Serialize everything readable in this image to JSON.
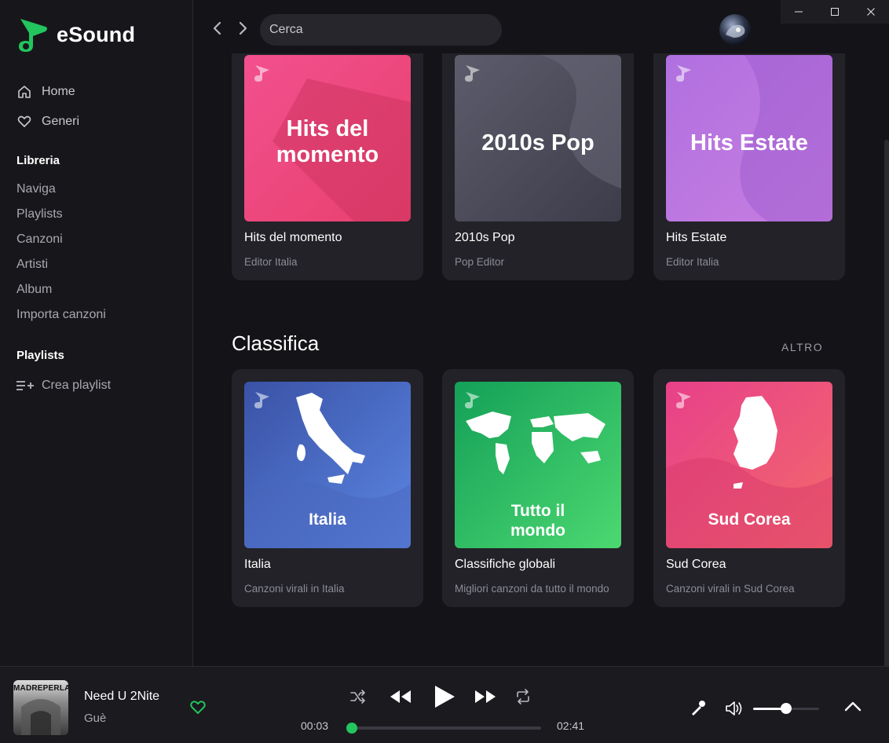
{
  "app": {
    "name": "eSound",
    "accent": "#22c55e"
  },
  "window": {
    "controls": [
      "minimize-icon",
      "maximize-icon",
      "close-icon"
    ]
  },
  "sidebar": {
    "main_nav": [
      {
        "label": "Home",
        "icon": "home-icon"
      },
      {
        "label": "Generi",
        "icon": "heart-icon"
      }
    ],
    "library_title": "Libreria",
    "library_items": [
      "Naviga",
      "Playlists",
      "Canzoni",
      "Artisti",
      "Album",
      "Importa canzoni"
    ],
    "playlists_title": "Playlists",
    "create_playlist": "Crea playlist"
  },
  "topbar": {
    "search_placeholder": "Cerca"
  },
  "sections": {
    "featured": {
      "cards": [
        {
          "art_title": "Hits del momento",
          "title": "Hits del momento",
          "subtitle": "Editor Italia",
          "colors": [
            "#f0508c",
            "#e8406e"
          ]
        },
        {
          "art_title": "2010s Pop",
          "title": "2010s Pop",
          "subtitle": "Pop Editor",
          "colors": [
            "#5a5a6a",
            "#3e3e4c"
          ]
        },
        {
          "art_title": "Hits Estate",
          "title": "Hits Estate",
          "subtitle": "Editor Italia",
          "colors": [
            "#b06ee0",
            "#c278e0"
          ]
        }
      ]
    },
    "charts": {
      "title": "Classifica",
      "more": "ALTRO",
      "cards": [
        {
          "art_title": "Italia",
          "title": "Italia",
          "subtitle": "Canzoni virali in Italia",
          "colors": [
            "#3a54a8",
            "#5b84e0"
          ]
        },
        {
          "art_title": "Tutto il mondo",
          "title": "Classifiche globali",
          "subtitle": "Migliori canzoni da tutto il mondo",
          "colors": [
            "#16a058",
            "#4bd870"
          ]
        },
        {
          "art_title": "Sud Corea",
          "title": "Sud Corea",
          "subtitle": "Canzoni virali in Sud Corea",
          "colors": [
            "#e8408a",
            "#f26a6a"
          ]
        }
      ]
    }
  },
  "player": {
    "cover_label": "MADREPERLA",
    "track_title": "Need U 2Nite",
    "artist": "Guè",
    "elapsed": "00:03",
    "duration": "02:41",
    "progress_fraction": 0.02,
    "volume_fraction": 0.5
  }
}
